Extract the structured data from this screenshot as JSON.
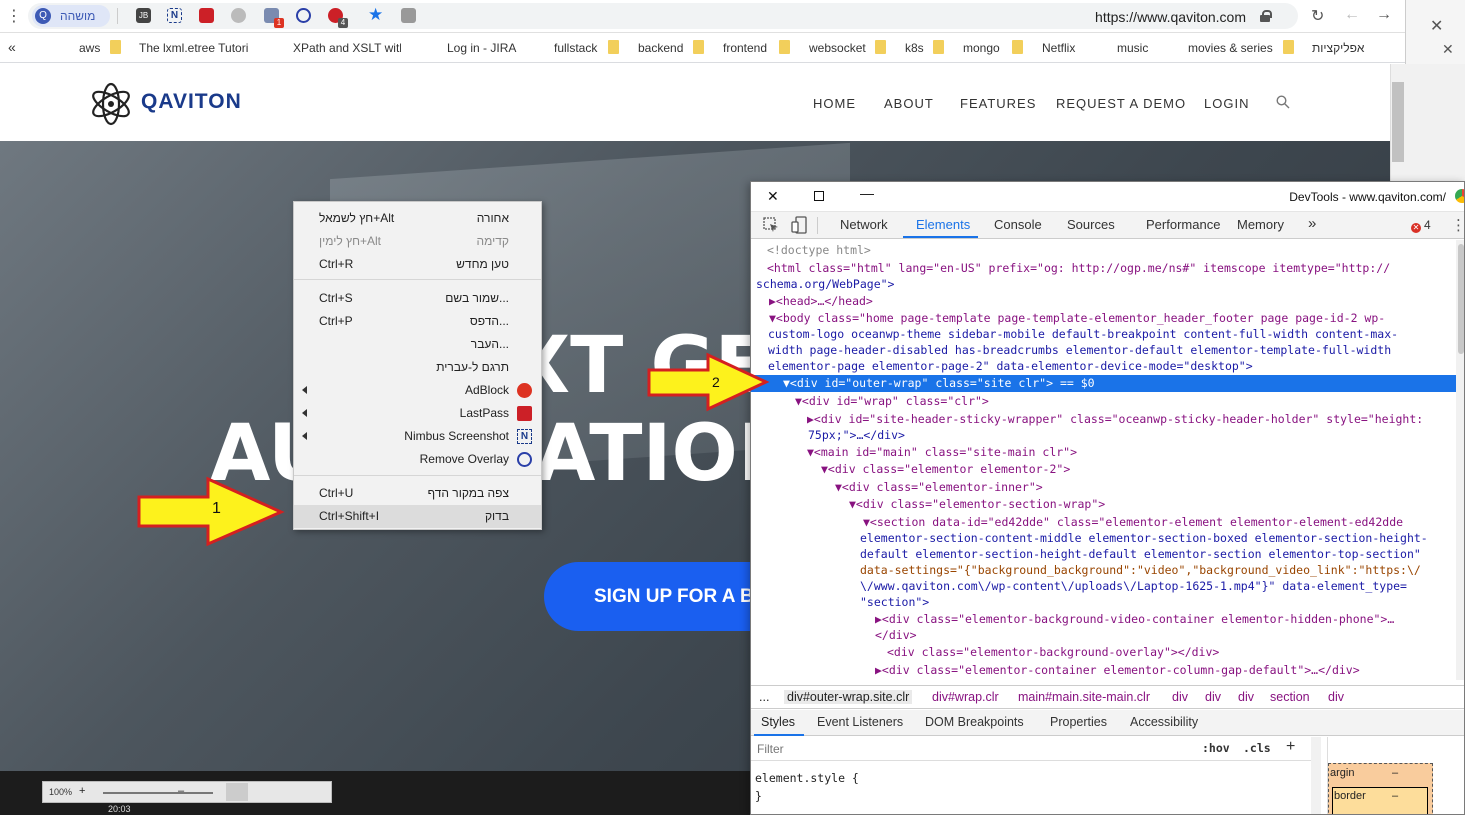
{
  "browser": {
    "profile_initial": "Q",
    "profile_name": "מושהה",
    "url": "https://www.qaviton.com",
    "badges": [
      "1",
      "4"
    ]
  },
  "bookmarks": {
    "overflow": "«",
    "items": [
      "aws",
      "The lxml.etree Tutori",
      "XPath and XSLT with",
      "Log in - JIRA",
      "fullstack",
      "backend",
      "frontend",
      "websocket",
      "k8s",
      "mongo",
      "Netflix",
      "music",
      "movies & series",
      "אפליקציות"
    ]
  },
  "site": {
    "logo": "QAVITON",
    "nav": [
      "HOME",
      "ABOUT",
      "FEATURES",
      "REQUEST A DEMO",
      "LOGIN"
    ],
    "hero_line1": "XT GE",
    "hero_line2_left": "AU",
    "hero_line2_right": "ATION",
    "cta": "SIGN UP FOR A B"
  },
  "context_menu": {
    "items": [
      {
        "label": "אחורה",
        "shortcut": "חץ לשמאל+Alt",
        "disabled": false
      },
      {
        "label": "קדימה",
        "shortcut": "חץ לימין+Alt",
        "disabled": true
      },
      {
        "label": "טען מחדש",
        "shortcut": "Ctrl+R",
        "disabled": false
      },
      {
        "label": "שמור בשם...",
        "shortcut": "Ctrl+S",
        "disabled": false
      },
      {
        "label": "הדפס...",
        "shortcut": "Ctrl+P",
        "disabled": false
      },
      {
        "label": "העבר...",
        "shortcut": "",
        "disabled": false
      },
      {
        "label": "תרגם ל-עברית",
        "shortcut": "",
        "disabled": false
      },
      {
        "label": "AdBlock",
        "shortcut": "",
        "disabled": false
      },
      {
        "label": "LastPass",
        "shortcut": "",
        "disabled": false
      },
      {
        "label": "Nimbus Screenshot",
        "shortcut": "",
        "disabled": false
      },
      {
        "label": "Remove Overlay",
        "shortcut": "",
        "disabled": false
      },
      {
        "label": "צפה במקור הדף",
        "shortcut": "Ctrl+U",
        "disabled": false
      },
      {
        "label": "בדוק",
        "shortcut": "Ctrl+Shift+I",
        "disabled": false
      }
    ]
  },
  "annotations": {
    "arrow1": "1",
    "arrow2": "2"
  },
  "devtools": {
    "title": "DevTools - www.qaviton.com/",
    "tabs": [
      "Network",
      "Elements",
      "Console",
      "Sources",
      "Performance",
      "Memory",
      "»"
    ],
    "active_tab": "Elements",
    "error_count": "4",
    "dom": [
      "<!doctype html>",
      "<html class=\"html\" lang=\"en-US\" prefix=\"og: http://ogp.me/ns#\" itemscope itemtype=\"http://",
      "schema.org/WebPage\">",
      "▶<head>…</head>",
      "▼<body class=\"home page-template page-template-elementor_header_footer page page-id-2 wp-",
      "custom-logo oceanwp-theme sidebar-mobile default-breakpoint content-full-width content-max-",
      "width page-header-disabled has-breadcrumbs elementor-default elementor-template-full-width",
      "elementor-page elementor-page-2\" data-elementor-device-mode=\"desktop\">",
      "▼<div id=\"outer-wrap\" class=\"site clr\"> == $0",
      "▼<div id=\"wrap\" class=\"clr\">",
      "▶<div id=\"site-header-sticky-wrapper\" class=\"oceanwp-sticky-header-holder\" style=\"height:",
      "75px;\">…</div>",
      "▼<main id=\"main\" class=\"site-main clr\">",
      "▼<div class=\"elementor elementor-2\">",
      "▼<div class=\"elementor-inner\">",
      "▼<div class=\"elementor-section-wrap\">",
      "▼<section data-id=\"ed42dde\" class=\"elementor-element elementor-element-ed42dde",
      "elementor-section-content-middle elementor-section-boxed elementor-section-height-",
      "default elementor-section-height-default elementor-section elementor-top-section\"",
      "data-settings=\"{\"background_background\":\"video\",\"background_video_link\":\"https:\\/",
      "\\/www.qaviton.com\\/wp-content\\/uploads\\/Laptop-1625-1.mp4\"}\" data-element_type=",
      "\"section\">",
      "▶<div class=\"elementor-background-video-container elementor-hidden-phone\">…",
      "</div>",
      "<div class=\"elementor-background-overlay\"></div>",
      "▶<div class=\"elementor-container elementor-column-gap-default\">…</div>"
    ],
    "breadcrumbs": [
      "...",
      "div#outer-wrap.site.clr",
      "div#wrap.clr",
      "main#main.site-main.clr",
      "div",
      "div",
      "div",
      "section",
      "div"
    ],
    "subtabs": [
      "Styles",
      "Event Listeners",
      "DOM Breakpoints",
      "Properties",
      "Accessibility"
    ],
    "filter_placeholder": "Filter",
    "hov": ":hov",
    "cls": ".cls",
    "element_style": "element.style {\n}",
    "boxmodel": {
      "margin": "argin",
      "border": "border",
      "dash": "–"
    }
  },
  "taskbar": {
    "zoom": "100%",
    "clock": "20:03"
  }
}
